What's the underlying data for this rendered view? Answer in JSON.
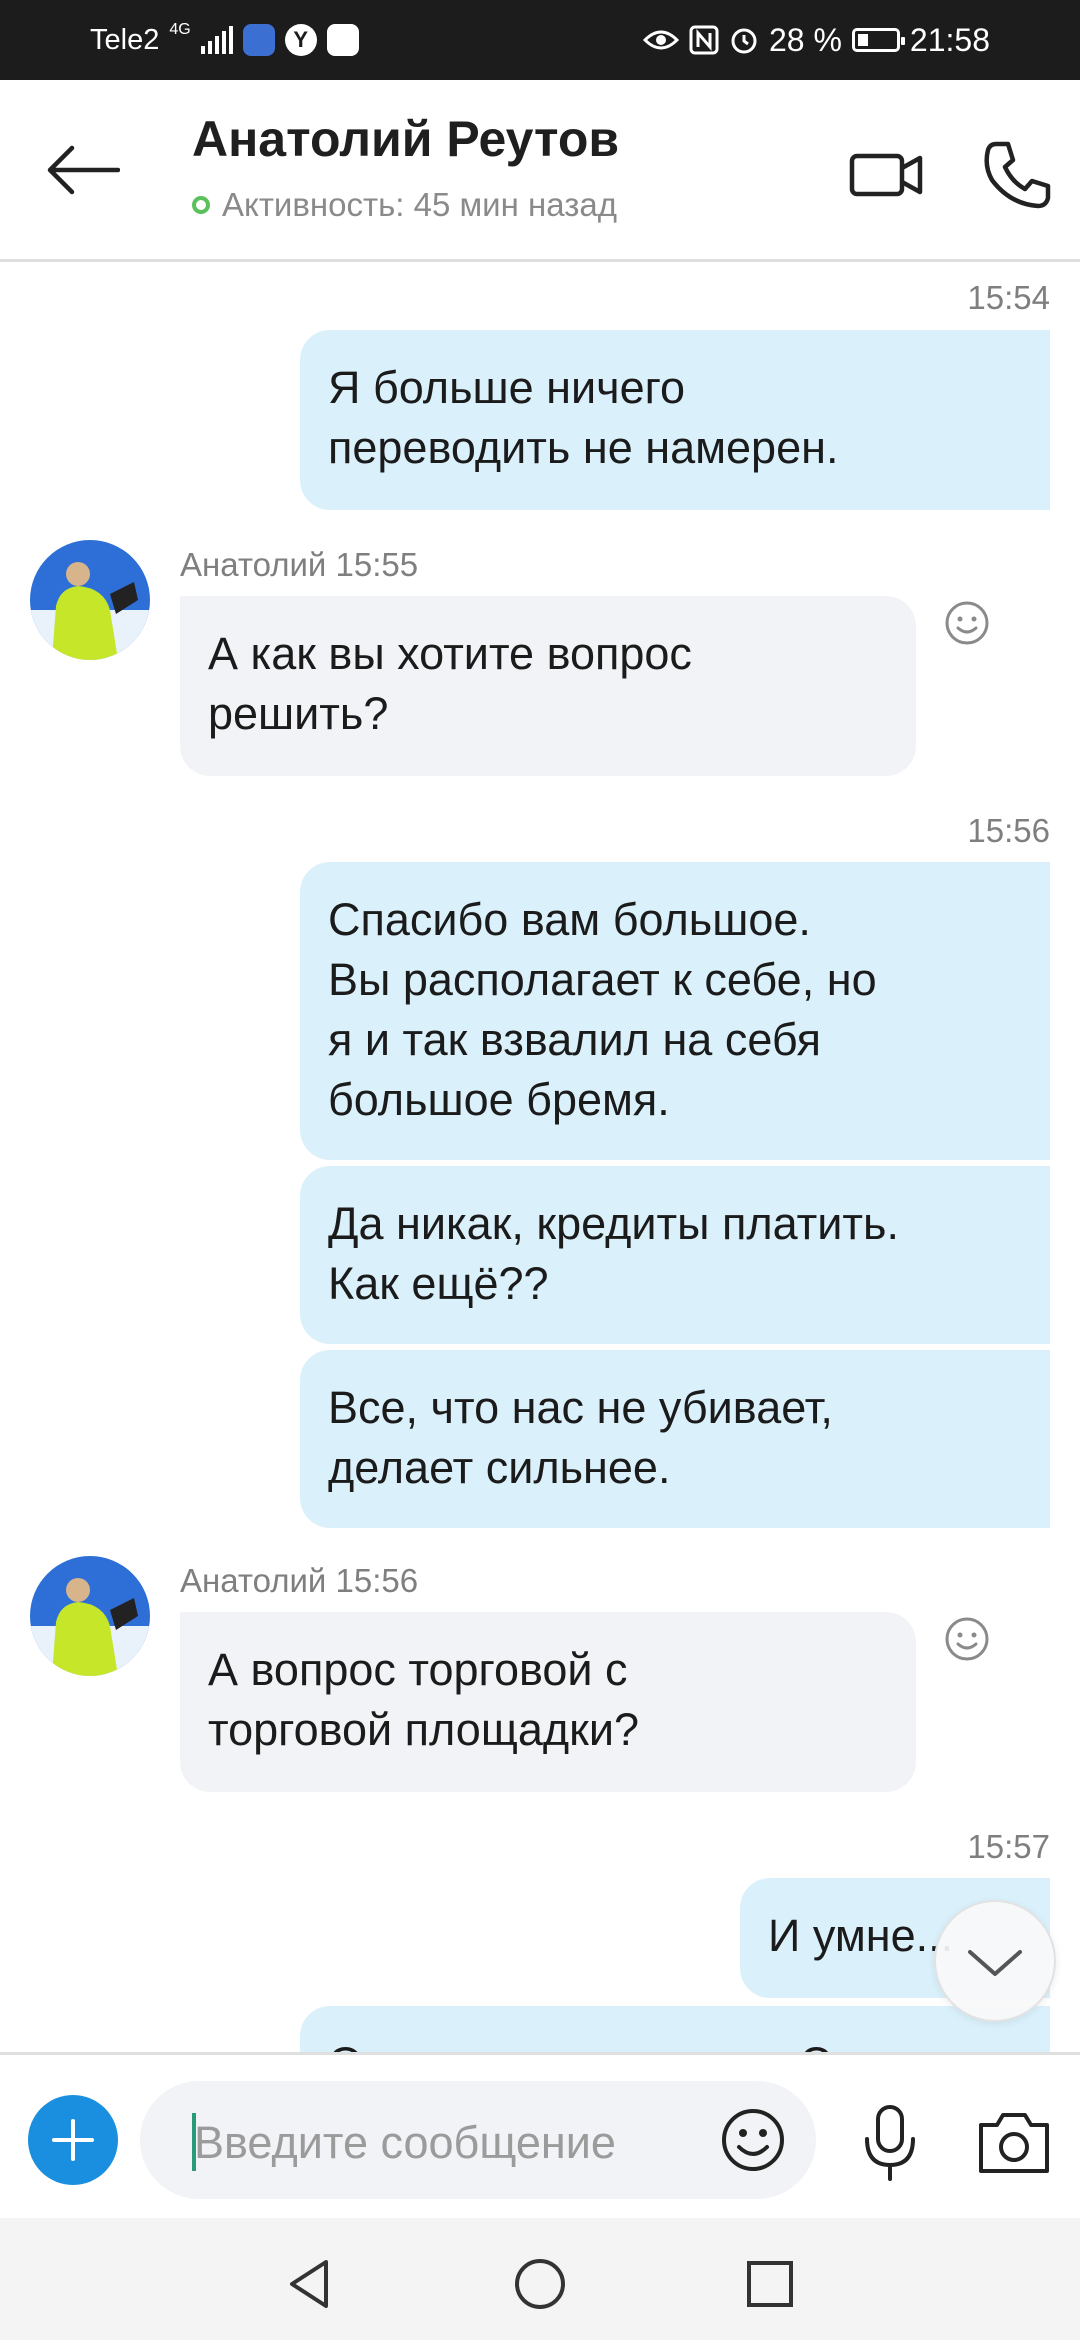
{
  "status_bar": {
    "carrier": "Tele2",
    "network": "4G",
    "battery_percent": "28 %",
    "battery_level": 0.28,
    "time": "21:58"
  },
  "header": {
    "contact_name": "Анатолий Реутов",
    "activity": "Активность: 45 мин назад"
  },
  "messages": [
    {
      "direction": "out",
      "time": "15:54",
      "text": "Я больше ничего\nпереводить не намерен."
    },
    {
      "direction": "in",
      "meta": "Анатолий 15:55",
      "text": "А как вы хотите вопрос\nрешить?"
    },
    {
      "direction": "out",
      "time": "15:56",
      "text": "Спасибо вам большое.\nВы располагает к себе, но\nя и так взвалил на себя\nбольшое бремя."
    },
    {
      "direction": "out",
      "text": "Да никак, кредиты платить.\nКак ещё??"
    },
    {
      "direction": "out",
      "text": "Все, что нас не убивает,\nделает сильнее."
    },
    {
      "direction": "in",
      "meta": "Анатолий 15:56",
      "text": "А вопрос торговой с\nторговой площадки?"
    },
    {
      "direction": "out",
      "time": "15:57",
      "text": "И умне..."
    },
    {
      "direction": "out",
      "text": "Они ничего не вернут. Это и"
    }
  ],
  "composer": {
    "placeholder": "Введите сообщение"
  },
  "icons": {
    "back": "arrow-left-icon",
    "video": "video-camera-icon",
    "call": "phone-icon",
    "add": "plus-icon",
    "emoji": "smiley-icon",
    "mic": "microphone-icon",
    "camera": "camera-icon",
    "scroll": "chevron-down-icon"
  },
  "colors": {
    "outgoing_bubble": "#daf1fc",
    "incoming_bubble": "#f1f3f6",
    "accent": "#1a8fe0",
    "online": "#5cc15c"
  }
}
